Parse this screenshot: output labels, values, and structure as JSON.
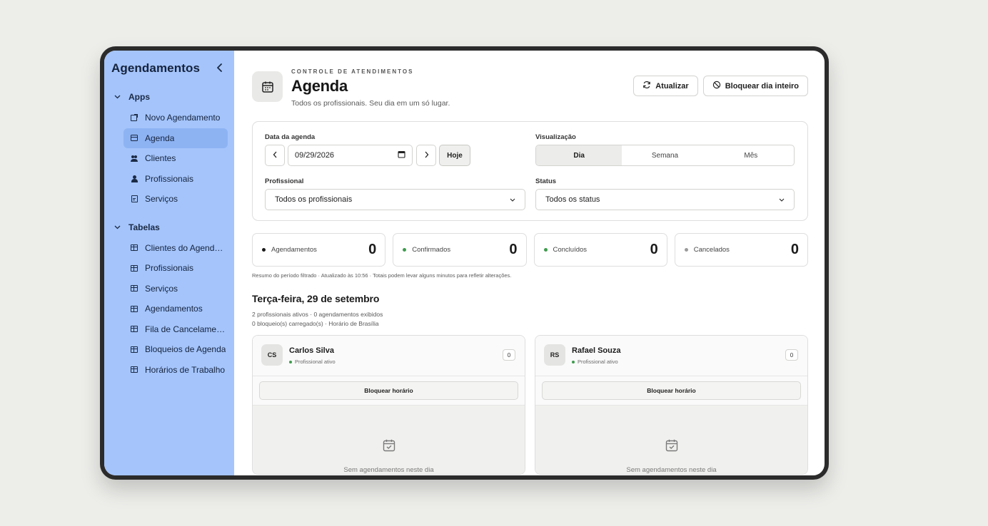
{
  "sidebar": {
    "title": "Agendamentos",
    "sections": [
      {
        "label": "Apps",
        "items": [
          {
            "label": "Novo Agendamento",
            "icon": "new-appointment-icon"
          },
          {
            "label": "Agenda",
            "icon": "calendar-icon",
            "active": true
          },
          {
            "label": "Clientes",
            "icon": "users-icon"
          },
          {
            "label": "Profissionais",
            "icon": "user-icon"
          },
          {
            "label": "Serviços",
            "icon": "list-icon"
          }
        ]
      },
      {
        "label": "Tabelas",
        "items": [
          {
            "label": "Clientes do Agendamento",
            "icon": "table-icon"
          },
          {
            "label": "Profissionais",
            "icon": "table-icon"
          },
          {
            "label": "Serviços",
            "icon": "table-icon"
          },
          {
            "label": "Agendamentos",
            "icon": "table-icon"
          },
          {
            "label": "Fila de Cancelamentos",
            "icon": "table-icon"
          },
          {
            "label": "Bloqueios de Agenda",
            "icon": "table-icon"
          },
          {
            "label": "Horários de Trabalho",
            "icon": "table-icon"
          }
        ]
      }
    ]
  },
  "header": {
    "kicker": "CONTROLE DE ATENDIMENTOS",
    "title": "Agenda",
    "subtitle": "Todos os profissionais. Seu dia em um só lugar.",
    "refresh_label": "Atualizar",
    "block_day_label": "Bloquear dia inteiro"
  },
  "filters": {
    "date_label": "Data da agenda",
    "date_value": "09/29/2026",
    "today_label": "Hoje",
    "view_label": "Visualização",
    "view_options": [
      "Dia",
      "Semana",
      "Mês"
    ],
    "view_selected": "Dia",
    "professional_label": "Profissional",
    "professional_value": "Todos os profissionais",
    "status_label": "Status",
    "status_value": "Todos os status"
  },
  "stats": [
    {
      "label": "Agendamentos",
      "value": "0",
      "color": "#1b1b1b"
    },
    {
      "label": "Confirmados",
      "value": "0",
      "color": "#3f9b4e"
    },
    {
      "label": "Concluídos",
      "value": "0",
      "color": "#3f9b4e"
    },
    {
      "label": "Cancelados",
      "value": "0",
      "color": "#9a9a9a"
    }
  ],
  "summary": "Resumo do período filtrado · Atualizado às 10:56 · Totais podem levar alguns minutos para refletir alterações.",
  "day": {
    "title": "Terça-feira, 29 de setembro",
    "meta1": "2 profissionais ativos · 0 agendamentos exibidos",
    "meta2": "0 bloqueio(s) carregado(s) · Horário de Brasília"
  },
  "professionals": [
    {
      "initials": "CS",
      "name": "Carlos Silva",
      "status": "Profissional ativo",
      "count": "0",
      "block_label": "Bloquear horário",
      "empty": "Sem agendamentos neste dia"
    },
    {
      "initials": "RS",
      "name": "Rafael Souza",
      "status": "Profissional ativo",
      "count": "0",
      "block_label": "Bloquear horário",
      "empty": "Sem agendamentos neste dia"
    }
  ],
  "colors": {
    "sidebar_bg": "#a4c4fb",
    "sidebar_active": "#8eb3f3",
    "status_green": "#3f9b4e"
  }
}
